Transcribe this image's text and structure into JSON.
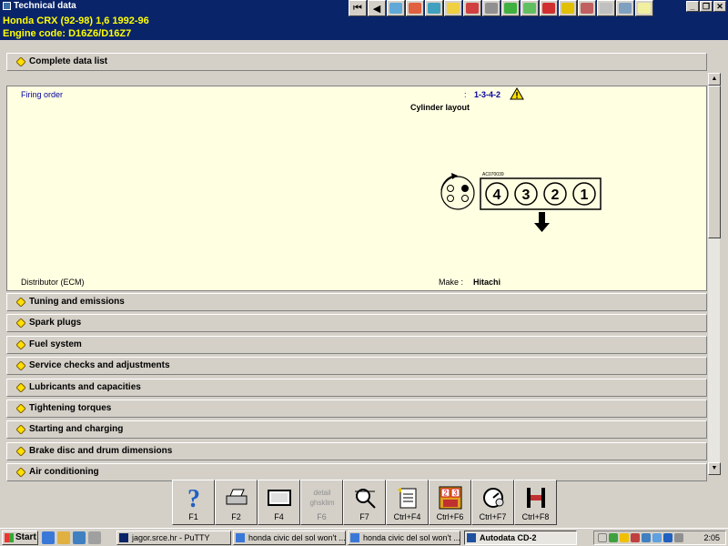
{
  "window": {
    "title": "Technical data",
    "vehicle_line1": "Honda   CRX (92-98) 1,6   1992-96",
    "vehicle_line2": "Engine code: D16Z6/D16Z7"
  },
  "complete_list": {
    "label": "Complete data list"
  },
  "firing": {
    "label": "Firing order",
    "colon": ":",
    "value": "1-3-4-2",
    "layout_title": "Cylinder layout",
    "diagram_code": "AC070039",
    "cylinders": [
      "4",
      "3",
      "2",
      "1"
    ]
  },
  "distributor": {
    "label": "Distributor (ECM)",
    "make_label": "Make :",
    "make_value": "Hitachi"
  },
  "sections": [
    "Tuning and emissions",
    "Spark plugs",
    "Fuel system",
    "Service checks and adjustments",
    "Lubricants and capacities",
    "Tightening torques",
    "Starting and charging",
    "Brake disc and drum dimensions",
    "Air conditioning"
  ],
  "fkeys": [
    {
      "label": "F1",
      "icon": "help-icon"
    },
    {
      "label": "F2",
      "icon": "printer-icon"
    },
    {
      "label": "F4",
      "icon": "monitor-icon"
    },
    {
      "label": "F6",
      "icon": "tables-icon",
      "glyph": "detail\nghsklim"
    },
    {
      "label": "F7",
      "icon": "magnifier-icon"
    },
    {
      "label": "Ctrl+F4",
      "icon": "notepad-icon"
    },
    {
      "label": "Ctrl+F6",
      "icon": "numbers-icon",
      "glyph": "2 3\n4 5"
    },
    {
      "label": "Ctrl+F7",
      "icon": "gauge-icon"
    },
    {
      "label": "Ctrl+F8",
      "icon": "lift-icon"
    }
  ],
  "taskbar": {
    "start": "Start",
    "tasks": [
      "jagor.srce.hr - PuTTY",
      "honda civic del sol won't ...",
      "honda civic del sol won't ...",
      "Autodata CD-2"
    ],
    "clock": "2:05"
  },
  "colors": {
    "title_bg": "#0a246a",
    "header_text": "#ffff00",
    "panel_bg": "#ffffe1",
    "label_blue": "#0000a0"
  }
}
